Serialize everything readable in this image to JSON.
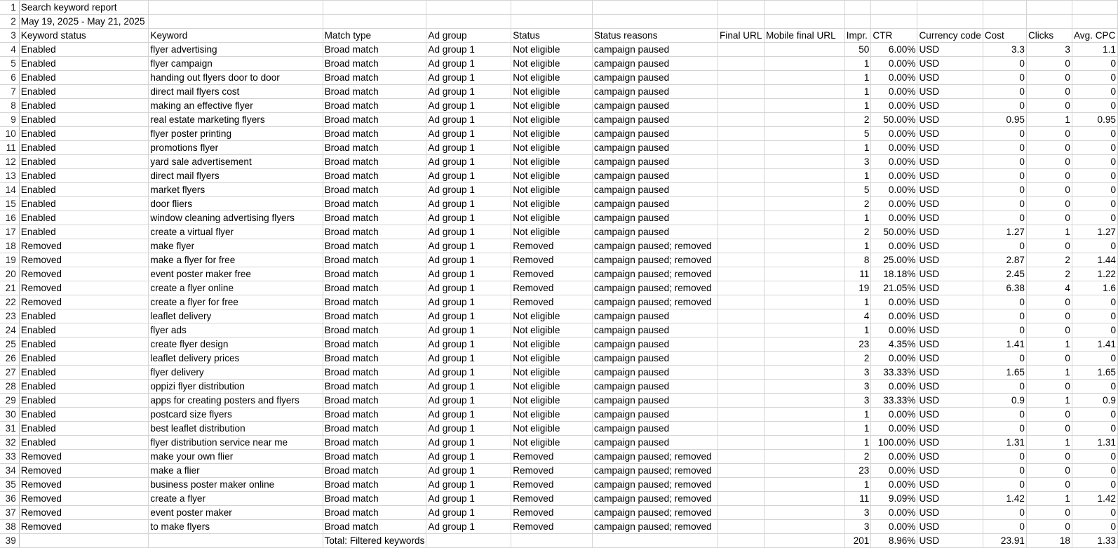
{
  "title_cell": "Search keyword report",
  "date_cell": "May 19, 2025 - May 21, 2025",
  "headers": [
    "Keyword status",
    "Keyword",
    "Match type",
    "Ad group",
    "Status",
    "Status reasons",
    "Final URL",
    "Mobile final URL",
    "Impr.",
    "CTR",
    "Currency code",
    "Cost",
    "Clicks",
    "Avg. CPC"
  ],
  "rows": [
    [
      "Enabled",
      "flyer advertising",
      "Broad match",
      "Ad group 1",
      "Not eligible",
      "campaign paused",
      "",
      "",
      "50",
      "6.00%",
      "USD",
      "3.3",
      "3",
      "1.1"
    ],
    [
      "Enabled",
      "flyer campaign",
      "Broad match",
      "Ad group 1",
      "Not eligible",
      "campaign paused",
      "",
      "",
      "1",
      "0.00%",
      "USD",
      "0",
      "0",
      "0"
    ],
    [
      "Enabled",
      "handing out flyers door to door",
      "Broad match",
      "Ad group 1",
      "Not eligible",
      "campaign paused",
      "",
      "",
      "1",
      "0.00%",
      "USD",
      "0",
      "0",
      "0"
    ],
    [
      "Enabled",
      "direct mail flyers cost",
      "Broad match",
      "Ad group 1",
      "Not eligible",
      "campaign paused",
      "",
      "",
      "1",
      "0.00%",
      "USD",
      "0",
      "0",
      "0"
    ],
    [
      "Enabled",
      "making an effective flyer",
      "Broad match",
      "Ad group 1",
      "Not eligible",
      "campaign paused",
      "",
      "",
      "1",
      "0.00%",
      "USD",
      "0",
      "0",
      "0"
    ],
    [
      "Enabled",
      "real estate marketing flyers",
      "Broad match",
      "Ad group 1",
      "Not eligible",
      "campaign paused",
      "",
      "",
      "2",
      "50.00%",
      "USD",
      "0.95",
      "1",
      "0.95"
    ],
    [
      "Enabled",
      "flyer poster printing",
      "Broad match",
      "Ad group 1",
      "Not eligible",
      "campaign paused",
      "",
      "",
      "5",
      "0.00%",
      "USD",
      "0",
      "0",
      "0"
    ],
    [
      "Enabled",
      "promotions flyer",
      "Broad match",
      "Ad group 1",
      "Not eligible",
      "campaign paused",
      "",
      "",
      "1",
      "0.00%",
      "USD",
      "0",
      "0",
      "0"
    ],
    [
      "Enabled",
      "yard sale advertisement",
      "Broad match",
      "Ad group 1",
      "Not eligible",
      "campaign paused",
      "",
      "",
      "3",
      "0.00%",
      "USD",
      "0",
      "0",
      "0"
    ],
    [
      "Enabled",
      "direct mail flyers",
      "Broad match",
      "Ad group 1",
      "Not eligible",
      "campaign paused",
      "",
      "",
      "1",
      "0.00%",
      "USD",
      "0",
      "0",
      "0"
    ],
    [
      "Enabled",
      "market flyers",
      "Broad match",
      "Ad group 1",
      "Not eligible",
      "campaign paused",
      "",
      "",
      "5",
      "0.00%",
      "USD",
      "0",
      "0",
      "0"
    ],
    [
      "Enabled",
      "door fliers",
      "Broad match",
      "Ad group 1",
      "Not eligible",
      "campaign paused",
      "",
      "",
      "2",
      "0.00%",
      "USD",
      "0",
      "0",
      "0"
    ],
    [
      "Enabled",
      "window cleaning advertising flyers",
      "Broad match",
      "Ad group 1",
      "Not eligible",
      "campaign paused",
      "",
      "",
      "1",
      "0.00%",
      "USD",
      "0",
      "0",
      "0"
    ],
    [
      "Enabled",
      "create a virtual flyer",
      "Broad match",
      "Ad group 1",
      "Not eligible",
      "campaign paused",
      "",
      "",
      "2",
      "50.00%",
      "USD",
      "1.27",
      "1",
      "1.27"
    ],
    [
      "Removed",
      "make flyer",
      "Broad match",
      "Ad group 1",
      "Removed",
      "campaign paused; removed",
      "",
      "",
      "1",
      "0.00%",
      "USD",
      "0",
      "0",
      "0"
    ],
    [
      "Removed",
      "make a flyer for free",
      "Broad match",
      "Ad group 1",
      "Removed",
      "campaign paused; removed",
      "",
      "",
      "8",
      "25.00%",
      "USD",
      "2.87",
      "2",
      "1.44"
    ],
    [
      "Removed",
      "event poster maker free",
      "Broad match",
      "Ad group 1",
      "Removed",
      "campaign paused; removed",
      "",
      "",
      "11",
      "18.18%",
      "USD",
      "2.45",
      "2",
      "1.22"
    ],
    [
      "Removed",
      "create a flyer online",
      "Broad match",
      "Ad group 1",
      "Removed",
      "campaign paused; removed",
      "",
      "",
      "19",
      "21.05%",
      "USD",
      "6.38",
      "4",
      "1.6"
    ],
    [
      "Removed",
      "create a flyer for free",
      "Broad match",
      "Ad group 1",
      "Removed",
      "campaign paused; removed",
      "",
      "",
      "1",
      "0.00%",
      "USD",
      "0",
      "0",
      "0"
    ],
    [
      "Enabled",
      "leaflet delivery",
      "Broad match",
      "Ad group 1",
      "Not eligible",
      "campaign paused",
      "",
      "",
      "4",
      "0.00%",
      "USD",
      "0",
      "0",
      "0"
    ],
    [
      "Enabled",
      "flyer ads",
      "Broad match",
      "Ad group 1",
      "Not eligible",
      "campaign paused",
      "",
      "",
      "1",
      "0.00%",
      "USD",
      "0",
      "0",
      "0"
    ],
    [
      "Enabled",
      "create flyer design",
      "Broad match",
      "Ad group 1",
      "Not eligible",
      "campaign paused",
      "",
      "",
      "23",
      "4.35%",
      "USD",
      "1.41",
      "1",
      "1.41"
    ],
    [
      "Enabled",
      "leaflet delivery prices",
      "Broad match",
      "Ad group 1",
      "Not eligible",
      "campaign paused",
      "",
      "",
      "2",
      "0.00%",
      "USD",
      "0",
      "0",
      "0"
    ],
    [
      "Enabled",
      "flyer delivery",
      "Broad match",
      "Ad group 1",
      "Not eligible",
      "campaign paused",
      "",
      "",
      "3",
      "33.33%",
      "USD",
      "1.65",
      "1",
      "1.65"
    ],
    [
      "Enabled",
      "oppizi flyer distribution",
      "Broad match",
      "Ad group 1",
      "Not eligible",
      "campaign paused",
      "",
      "",
      "3",
      "0.00%",
      "USD",
      "0",
      "0",
      "0"
    ],
    [
      "Enabled",
      "apps for creating posters and flyers",
      "Broad match",
      "Ad group 1",
      "Not eligible",
      "campaign paused",
      "",
      "",
      "3",
      "33.33%",
      "USD",
      "0.9",
      "1",
      "0.9"
    ],
    [
      "Enabled",
      "postcard size flyers",
      "Broad match",
      "Ad group 1",
      "Not eligible",
      "campaign paused",
      "",
      "",
      "1",
      "0.00%",
      "USD",
      "0",
      "0",
      "0"
    ],
    [
      "Enabled",
      "best leaflet distribution",
      "Broad match",
      "Ad group 1",
      "Not eligible",
      "campaign paused",
      "",
      "",
      "1",
      "0.00%",
      "USD",
      "0",
      "0",
      "0"
    ],
    [
      "Enabled",
      "flyer distribution service near me",
      "Broad match",
      "Ad group 1",
      "Not eligible",
      "campaign paused",
      "",
      "",
      "1",
      "100.00%",
      "USD",
      "1.31",
      "1",
      "1.31"
    ],
    [
      "Removed",
      "make your own flier",
      "Broad match",
      "Ad group 1",
      "Removed",
      "campaign paused; removed",
      "",
      "",
      "2",
      "0.00%",
      "USD",
      "0",
      "0",
      "0"
    ],
    [
      "Removed",
      "make a flier",
      "Broad match",
      "Ad group 1",
      "Removed",
      "campaign paused; removed",
      "",
      "",
      "23",
      "0.00%",
      "USD",
      "0",
      "0",
      "0"
    ],
    [
      "Removed",
      "business poster maker online",
      "Broad match",
      "Ad group 1",
      "Removed",
      "campaign paused; removed",
      "",
      "",
      "1",
      "0.00%",
      "USD",
      "0",
      "0",
      "0"
    ],
    [
      "Removed",
      "create a flyer",
      "Broad match",
      "Ad group 1",
      "Removed",
      "campaign paused; removed",
      "",
      "",
      "11",
      "9.09%",
      "USD",
      "1.42",
      "1",
      "1.42"
    ],
    [
      "Removed",
      "event poster maker",
      "Broad match",
      "Ad group 1",
      "Removed",
      "campaign paused; removed",
      "",
      "",
      "3",
      "0.00%",
      "USD",
      "0",
      "0",
      "0"
    ],
    [
      "Removed",
      "to make flyers",
      "Broad match",
      "Ad group 1",
      "Removed",
      "campaign paused; removed",
      "",
      "",
      "3",
      "0.00%",
      "USD",
      "0",
      "0",
      "0"
    ]
  ],
  "total_row": [
    "",
    "",
    "Total: Filtered keywords",
    "",
    "",
    "",
    "",
    "",
    "201",
    "8.96%",
    "USD",
    "23.91",
    "18",
    "1.33"
  ]
}
